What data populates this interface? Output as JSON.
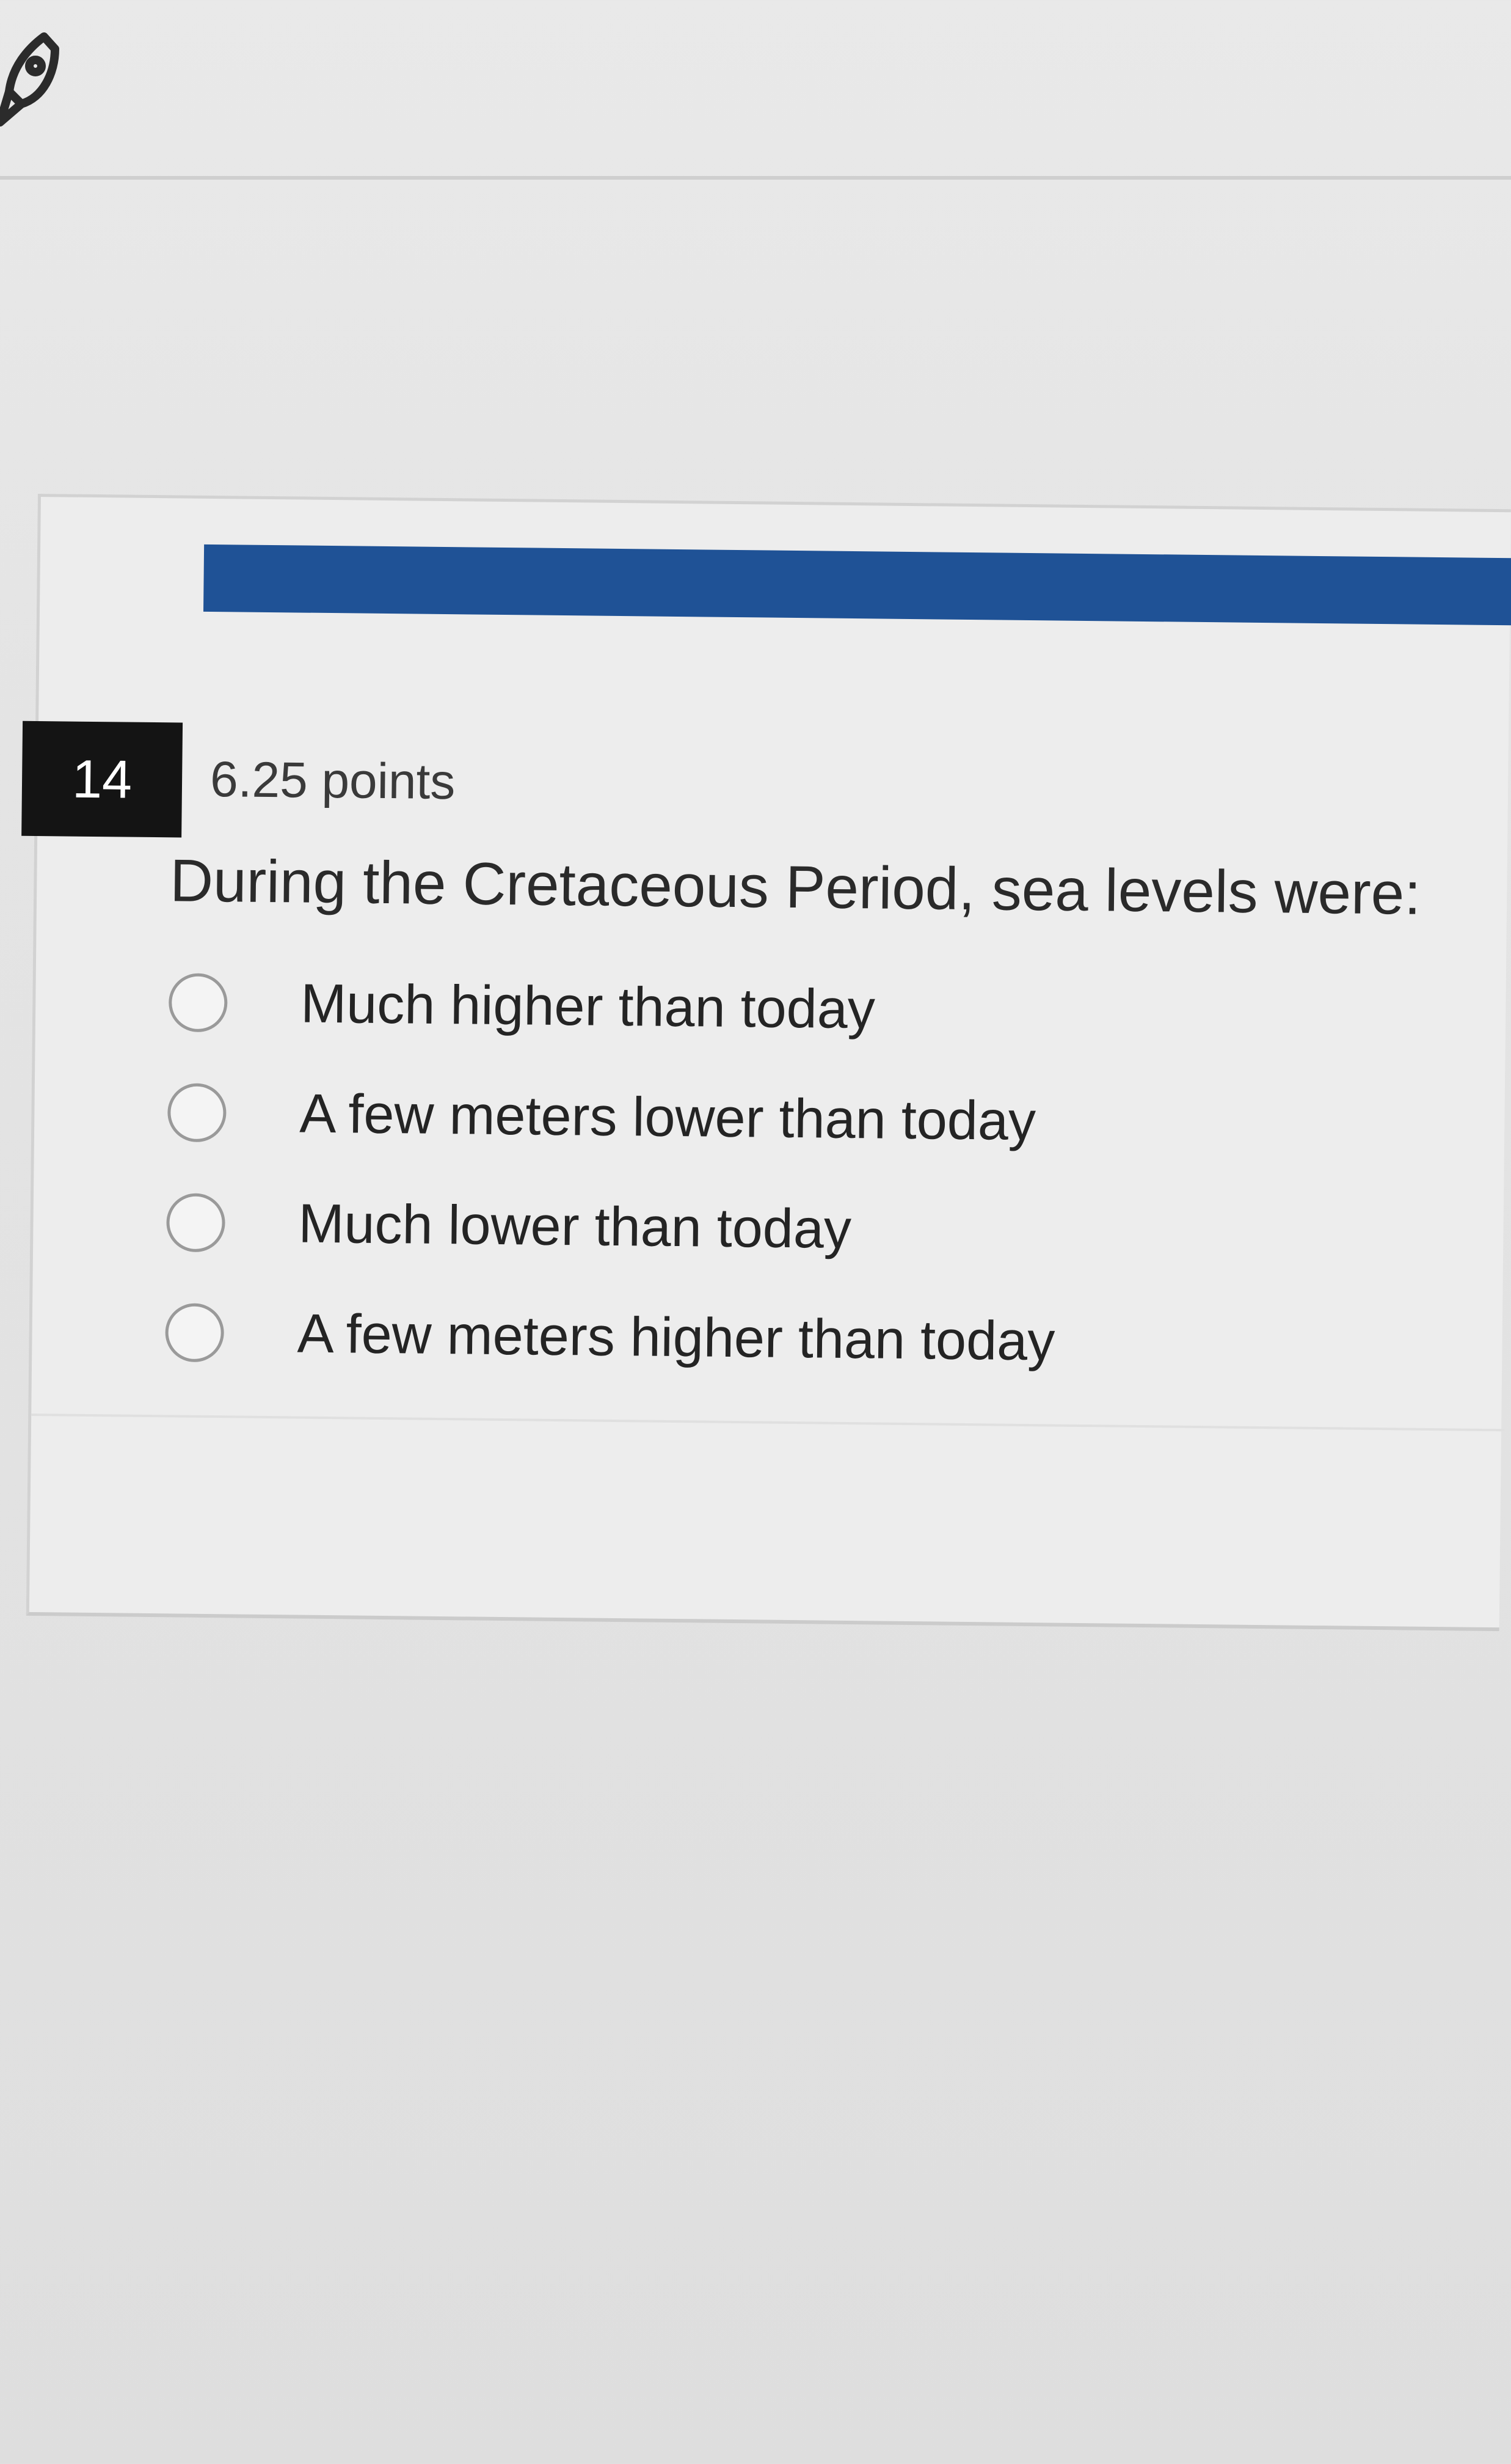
{
  "question": {
    "number": "14",
    "points": "6.25 points",
    "text": "During the Cretaceous Period, sea levels were:",
    "answers": [
      {
        "label": "Much higher than today"
      },
      {
        "label": "A few meters lower than today"
      },
      {
        "label": "Much lower than today"
      },
      {
        "label": "A few meters higher than today"
      }
    ]
  },
  "colors": {
    "header_bar": "#1f5296",
    "number_badge": "#141414"
  },
  "icons": {
    "top_left": "rocket-icon"
  }
}
